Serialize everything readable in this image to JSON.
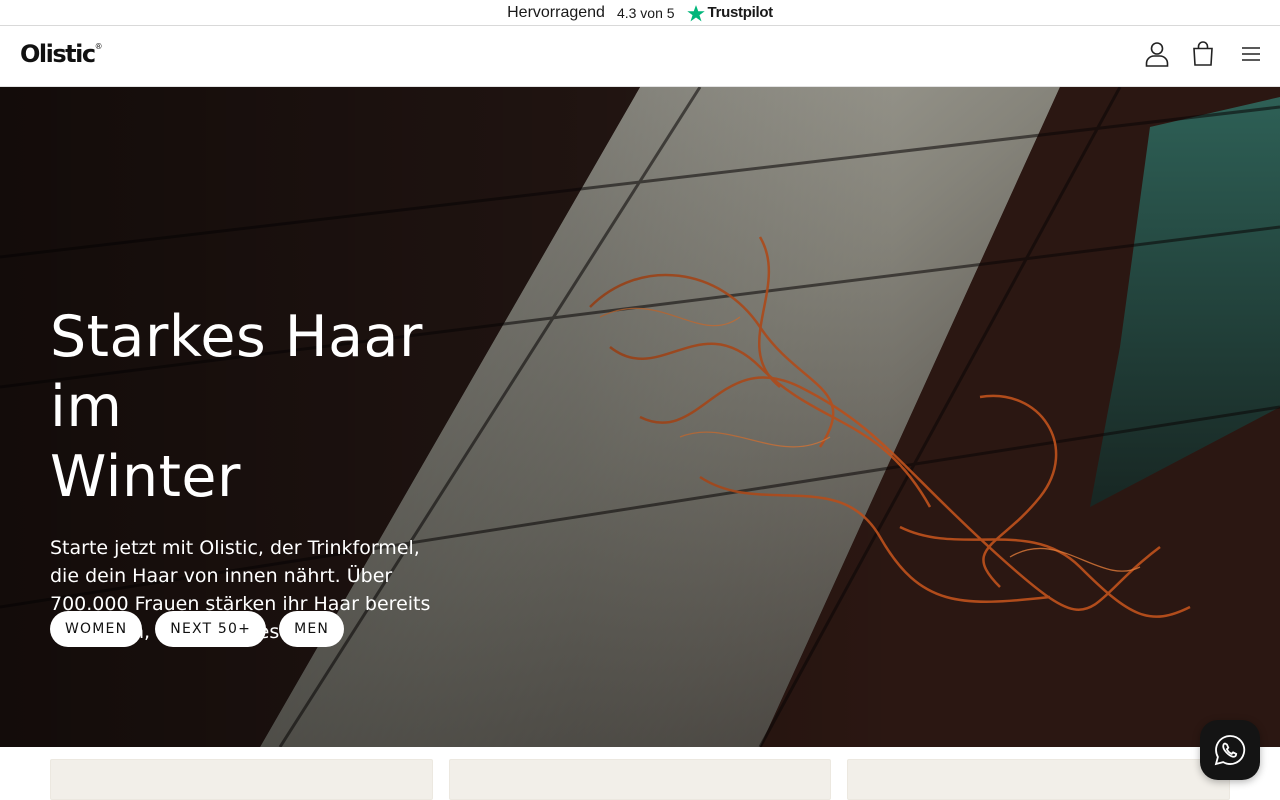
{
  "trustpilot": {
    "rating_word": "Hervorragend",
    "score": "4.3 von 5",
    "brand": "Trustpilot",
    "star_color": "#00b67a"
  },
  "header": {
    "logo_text": "Olistic",
    "logo_mark": "®",
    "icons": [
      "user-icon",
      "cart-icon",
      "menu-icon"
    ]
  },
  "hero": {
    "title_line1": "Starkes Haar im",
    "title_line2": "Winter",
    "text": "Starte jetzt mit Olistic, der Trinkformel, die dein Haar von innen nährt. Über 700.000 Frauen stärken ihr Haar bereits von innen, wann startest du?",
    "buttons": [
      "WOMEN",
      "NEXT 50+",
      "MEN"
    ]
  },
  "chat": {
    "icon": "whatsapp-icon"
  },
  "colors": {
    "card_bg": "#f2efe9",
    "chat_bg": "#141414"
  }
}
